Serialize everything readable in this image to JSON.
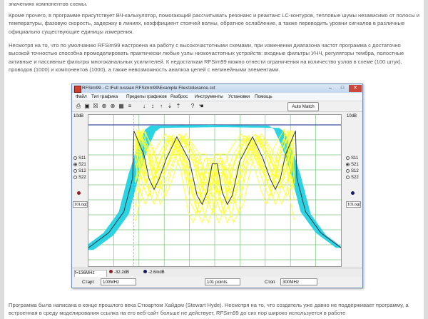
{
  "article": {
    "line0": "значениях компонентов схемы.",
    "para1": "Кроме прочего, в программе присутствует ВЧ-калькулятор, помогающий рассчитывать резонанс и реактанс LC-контуров, тепловые шумы независимо от полосы и температуры, фазовую скорость, задержку в линиях, коэффициент стоячей волны, обратное ослабление, а также переводить уровни сигналов в различные официально существующие единицы измерения.",
    "para2": "Несмотря на то, что по умолчанию RFSim99 настроена на работу с высокочастотными схемами, при изменении диапазона частот программа с достаточно высокой точностью способна промоделировать практически любые узлы низкочастотных устройств: входные фильтры УНЧ, регуляторы тембра, полостные активные и пассивные фильтры многоканальных усилителей. К недостаткам RFSim99 можно отнести ограничения на количество узлов в схеме (100 штук), проводов (1000) и компонентов (1000), а также невозможность анализа цепей с нелинейными элементами.",
    "para3": "Программа была написана в конце прошлого века Стюартом Хайдом (Stewart Hyde). Несмотря на то, что создатель уже давно не поддерживает программу, а встроенная в среду моделирования ссылка на его веб-сайт больше не действует, RFSim99 до сих пор широко используется в работе"
  },
  "window": {
    "title": "RFSim99 - C:\\Full russian RFSimm99\\Example Files\\tolerance.cct",
    "controls": {
      "minimize": "–",
      "maximize": "□",
      "close": "✕"
    },
    "menu": [
      "Файл",
      "Тип графика",
      "Пределы графиков",
      "Разброс",
      "Инструменты",
      "Установки",
      "Помощь"
    ],
    "toolbar_icons": [
      "print-icon",
      "save-icon",
      "close-box-icon",
      "crosshair-icon",
      "crosshair-circle-icon",
      "grid-icon",
      "lines-icon",
      "arrow-down-icon",
      "arrow-up-down-icon",
      "arrow-up-icon",
      "arrow-down-alt-icon",
      "arrow-up-alt-icon",
      "question-icon",
      "hand-icon"
    ],
    "toolbar_glyphs": [
      "⎙",
      "▣",
      "☒",
      "⊕",
      "⊗",
      "▦",
      "≡",
      "↓",
      "↕",
      "↑",
      "⇣",
      "⇡",
      "?",
      "☚"
    ],
    "auto_match": "Auto Match",
    "left_panel": {
      "top_label": "10dB",
      "options": [
        "S11",
        "S21",
        "S12",
        "S22"
      ],
      "selected": "S21",
      "mode": "10Log(P",
      "marker_color": "#8b2020"
    },
    "right_panel": {
      "top_label": "10dB",
      "options": [
        "S11",
        "S21",
        "S12",
        "S22"
      ],
      "selected": "S21",
      "mode": "10Log(P",
      "marker_color": "#1a1a60"
    },
    "status": {
      "freq": "f=136MHz",
      "marker1": "-32.2dB",
      "marker2": "-2.6mdB"
    },
    "bottom": {
      "start_label": "Старт",
      "start_value": "100MHz",
      "points": "101 points",
      "stop_label": "Стоп",
      "stop_value": "300MHz"
    }
  },
  "chart_data": {
    "type": "line",
    "title": "",
    "xlabel": "",
    "ylabel": "",
    "x_range_mhz": [
      100,
      300
    ],
    "y_division_db": 10,
    "grid": true,
    "colors": {
      "cyan_band": "#2cd3e3",
      "yellow_band": "#ffff33",
      "mean_trace": "#2c3440",
      "ref_line": "#3d4f9f",
      "grid": "#7fc57f"
    },
    "series": [
      {
        "values_db": [
          {
            "f": 100,
            "db": -82
          },
          {
            "f": 116,
            "db": -72
          },
          {
            "f": 128,
            "db": -58
          },
          {
            "f": 136,
            "db": -32.2
          },
          {
            "f": 143,
            "db": -14
          },
          {
            "f": 149,
            "db": -3
          },
          {
            "f": 153,
            "db": -0.5
          },
          {
            "f": 200,
            "db": 0
          },
          {
            "f": 247,
            "db": -0.5
          },
          {
            "f": 251,
            "db": -3
          },
          {
            "f": 257,
            "db": -14
          },
          {
            "f": 264,
            "db": -32
          },
          {
            "f": 272,
            "db": -58
          },
          {
            "f": 284,
            "db": -72
          },
          {
            "f": 300,
            "db": -82
          }
        ]
      },
      {
        "values_db": [
          {
            "f": 135,
            "db": -2
          },
          {
            "f": 144,
            "db": -20
          },
          {
            "f": 148,
            "db": -36
          },
          {
            "f": 152,
            "db": -43
          },
          {
            "f": 156,
            "db": -36
          },
          {
            "f": 162,
            "db": -22
          },
          {
            "f": 170,
            "db": -8
          },
          {
            "f": 180,
            "db": -24
          },
          {
            "f": 186,
            "db": -47
          },
          {
            "f": 190,
            "db": -53
          },
          {
            "f": 194,
            "db": -45
          },
          {
            "f": 198,
            "db": -26
          },
          {
            "f": 202,
            "db": -26
          },
          {
            "f": 206,
            "db": -45
          },
          {
            "f": 210,
            "db": -53
          },
          {
            "f": 214,
            "db": -47
          },
          {
            "f": 220,
            "db": -24
          },
          {
            "f": 230,
            "db": -8
          },
          {
            "f": 238,
            "db": -22
          },
          {
            "f": 244,
            "db": -36
          },
          {
            "f": 248,
            "db": -43
          },
          {
            "f": 252,
            "db": -36
          },
          {
            "f": 256,
            "db": -20
          },
          {
            "f": 265,
            "db": -2
          }
        ]
      }
    ]
  }
}
